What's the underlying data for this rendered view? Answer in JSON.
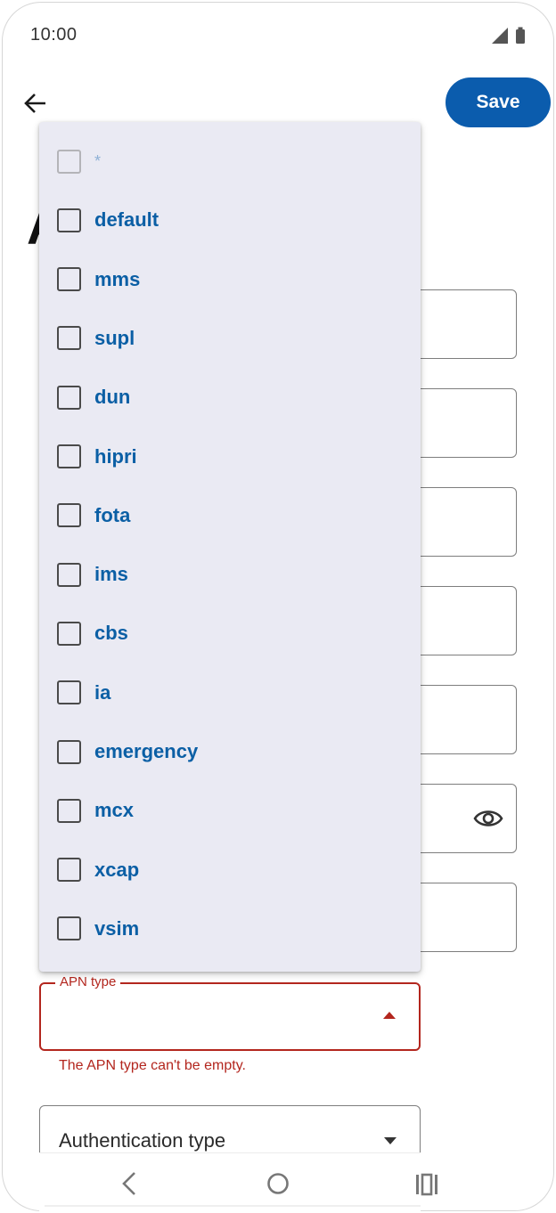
{
  "status_bar": {
    "time": "10:00",
    "icons": [
      "signal-icon",
      "battery-icon"
    ]
  },
  "app_bar": {
    "back_icon": "arrow-back-icon",
    "save_label": "Save"
  },
  "page": {
    "title_visible_fragment": "A"
  },
  "apn_type": {
    "label": "APN type",
    "value": "",
    "error": "The APN type can't be empty."
  },
  "auth_type": {
    "label": "Authentication type"
  },
  "dropdown": {
    "options": [
      {
        "label": "*",
        "checked": false,
        "disabled": true
      },
      {
        "label": "default",
        "checked": false
      },
      {
        "label": "mms",
        "checked": false
      },
      {
        "label": "supl",
        "checked": false
      },
      {
        "label": "dun",
        "checked": false
      },
      {
        "label": "hipri",
        "checked": false
      },
      {
        "label": "fota",
        "checked": false
      },
      {
        "label": "ims",
        "checked": false
      },
      {
        "label": "cbs",
        "checked": false
      },
      {
        "label": "ia",
        "checked": false
      },
      {
        "label": "emergency",
        "checked": false
      },
      {
        "label": "mcx",
        "checked": false
      },
      {
        "label": "xcap",
        "checked": false
      },
      {
        "label": "vsim",
        "checked": false
      }
    ]
  },
  "nav_bar": {
    "icons": [
      "nav-back-icon",
      "nav-home-icon",
      "nav-recents-icon"
    ]
  },
  "colors": {
    "accent": "#0b5cad",
    "option_text": "#0b5fa5",
    "error": "#b3261e",
    "menu_bg": "#eaeaf3"
  }
}
